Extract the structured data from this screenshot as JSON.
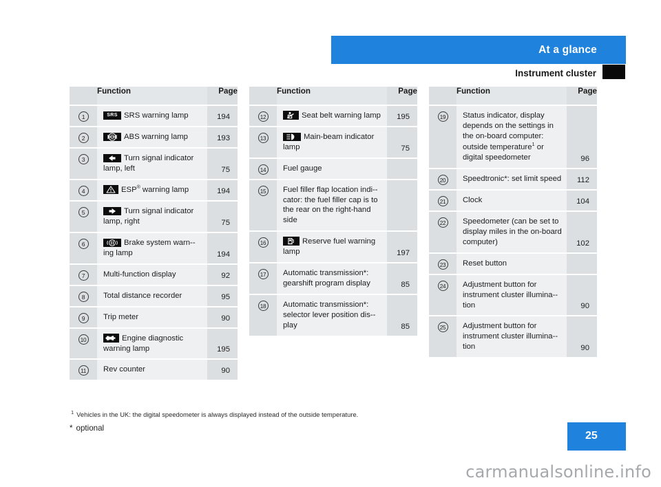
{
  "header": {
    "band_title": "At a glance",
    "section_title": "Instrument cluster",
    "band_color": "#1f82dd",
    "marker_color": "#0a0a0a"
  },
  "table_headers": {
    "function": "Function",
    "page": "Page"
  },
  "columns": [
    {
      "id": "column-1",
      "rows": [
        {
          "num": "1",
          "icon": "srs-warning-icon",
          "text": "SRS warning lamp",
          "page": "194"
        },
        {
          "num": "2",
          "icon": "abs-warning-icon",
          "text": "ABS warning lamp",
          "page": "193"
        },
        {
          "num": "3",
          "icon": "turn-signal-left-icon",
          "text": "Turn signal indicator lamp, left",
          "page": "75"
        },
        {
          "num": "4",
          "icon": "esp-warning-icon",
          "text": "ESP® warning lamp",
          "page": "194",
          "reg": true
        },
        {
          "num": "5",
          "icon": "turn-signal-right-icon",
          "text": "Turn signal indicator lamp, right",
          "page": "75"
        },
        {
          "num": "6",
          "icon": "brake-system-warning-icon",
          "text": "Brake system warn-­ing lamp",
          "page": "194"
        },
        {
          "num": "7",
          "icon": null,
          "text": "Multi-function display",
          "page": "92"
        },
        {
          "num": "8",
          "icon": null,
          "text": "Total distance recorder",
          "page": "95"
        },
        {
          "num": "9",
          "icon": null,
          "text": "Trip meter",
          "page": "90"
        },
        {
          "num": "10",
          "icon": "engine-diagnostic-icon",
          "text": "Engine diagnostic warning lamp",
          "page": "195"
        },
        {
          "num": "11",
          "icon": null,
          "text": "Rev counter",
          "page": "90"
        }
      ]
    },
    {
      "id": "column-2",
      "rows": [
        {
          "num": "12",
          "icon": "seat-belt-warning-icon",
          "text": "Seat belt warning lamp",
          "page": "195"
        },
        {
          "num": "13",
          "icon": "main-beam-indicator-icon",
          "text": "Main-beam indicator lamp",
          "page": "75"
        },
        {
          "num": "14",
          "icon": null,
          "text": "Fuel gauge",
          "page": ""
        },
        {
          "num": "15",
          "icon": null,
          "text": "Fuel filler flap location indi-­cator: the fuel filler cap is to the rear on the right-hand side",
          "page": ""
        },
        {
          "num": "16",
          "icon": "reserve-fuel-warning-icon",
          "text": "Reserve fuel warning lamp",
          "page": "197"
        },
        {
          "num": "17",
          "icon": null,
          "text": "Automatic transmission*: gearshift program display",
          "page": "85"
        },
        {
          "num": "18",
          "icon": null,
          "text": "Automatic transmission*: selector lever position dis-­play",
          "page": "85"
        }
      ]
    },
    {
      "id": "column-3",
      "rows": [
        {
          "num": "19",
          "icon": null,
          "text": "Status indicator, display depends on the settings in the on-board computer: outside temperature¹ or digital speedometer",
          "page": "96",
          "footnote": true
        },
        {
          "num": "20",
          "icon": null,
          "text": "Speedtronic*: set limit speed",
          "page": "112"
        },
        {
          "num": "21",
          "icon": null,
          "text": "Clock",
          "page": "104"
        },
        {
          "num": "22",
          "icon": null,
          "text": "Speedometer (can be set to display miles in the on-­board computer)",
          "page": "102"
        },
        {
          "num": "23",
          "icon": null,
          "text": "Reset button",
          "page": ""
        },
        {
          "num": "24",
          "icon": null,
          "text": "Adjustment button for instrument cluster illumina-­tion",
          "page": "90"
        },
        {
          "num": "25",
          "icon": null,
          "text": "Adjustment button for instrument cluster illumina-­tion",
          "page": "90"
        }
      ]
    }
  ],
  "footnotes": {
    "one_mark": "1",
    "one_text": "Vehicles in the UK: the digital speedometer is always displayed instead of the outside temperature.",
    "star_mark": "*",
    "star_text": "optional"
  },
  "page_number": "25",
  "watermark": "carmanualsonline.info"
}
